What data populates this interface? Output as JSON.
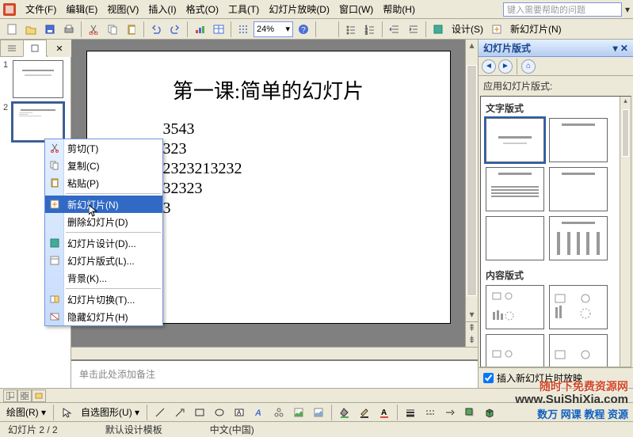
{
  "menu": {
    "items": [
      "文件(F)",
      "编辑(E)",
      "视图(V)",
      "插入(I)",
      "格式(O)",
      "工具(T)",
      "幻灯片放映(D)",
      "窗口(W)",
      "帮助(H)"
    ],
    "help_placeholder": "键入需要帮助的问题"
  },
  "toolbar": {
    "zoom": "24%",
    "design_label": "设计(S)",
    "newslide_label": "新幻灯片(N)"
  },
  "thumbnails": {
    "nums": [
      "1",
      "2"
    ]
  },
  "slide": {
    "title": "第一课:简单的幻灯片",
    "lines": [
      "3543",
      "323",
      "2323213232",
      "32323",
      "3"
    ]
  },
  "notes": {
    "placeholder": "单击此处添加备注"
  },
  "taskpane": {
    "title": "幻灯片版式",
    "apply_label": "应用幻灯片版式:",
    "section_text": "文字版式",
    "section_content": "内容版式",
    "footer_check": "插入新幻灯片时放映"
  },
  "context_menu": {
    "items": [
      {
        "label": "剪切(T)",
        "icon": "cut"
      },
      {
        "label": "复制(C)",
        "icon": "copy"
      },
      {
        "label": "粘贴(P)",
        "icon": "paste"
      },
      {
        "sep": true
      },
      {
        "label": "新幻灯片(N)",
        "icon": "newslide",
        "highlight": true
      },
      {
        "label": "删除幻灯片(D)",
        "icon": ""
      },
      {
        "sep": true
      },
      {
        "label": "幻灯片设计(D)...",
        "icon": "design"
      },
      {
        "label": "幻灯片版式(L)...",
        "icon": "layout"
      },
      {
        "label": "背景(K)...",
        "icon": ""
      },
      {
        "sep": true
      },
      {
        "label": "幻灯片切换(T)...",
        "icon": "transition"
      },
      {
        "label": "隐藏幻灯片(H)",
        "icon": "hide"
      }
    ]
  },
  "drawbar": {
    "draw": "绘图(R)",
    "autoshape": "自选图形(U)"
  },
  "status": {
    "slide": "幻灯片 2 / 2",
    "template": "默认设计模板",
    "lang": "中文(中国)"
  },
  "watermark": {
    "l1": "随时下免费资源网",
    "l2": "www.SuiShiXia.com",
    "l3": "数万 网课 教程 资源"
  }
}
